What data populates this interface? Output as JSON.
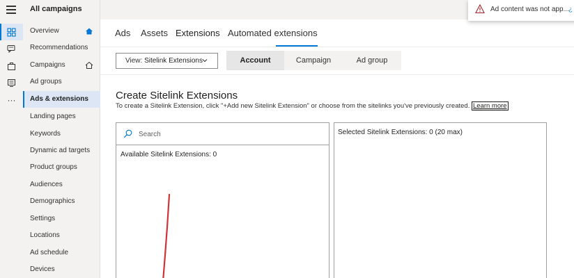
{
  "app": {
    "title": "All campaigns"
  },
  "toast": {
    "message": "Ad content was not app...",
    "trailing": "¿"
  },
  "nav": {
    "items": [
      {
        "label": "Overview",
        "icon": "home-icon"
      },
      {
        "label": "Recommendations"
      },
      {
        "label": "Campaigns",
        "icon": "home-outline-icon"
      },
      {
        "label": "Ad groups"
      },
      {
        "label": "Ads & extensions",
        "selected": true
      },
      {
        "label": "Landing pages"
      },
      {
        "label": "Keywords"
      },
      {
        "label": "Dynamic ad targets"
      },
      {
        "label": "Product groups"
      },
      {
        "label": "Audiences"
      },
      {
        "label": "Demographics"
      },
      {
        "label": "Settings"
      },
      {
        "label": "Locations"
      },
      {
        "label": "Ad schedule"
      },
      {
        "label": "Devices"
      }
    ]
  },
  "rail": {
    "more": "···"
  },
  "tabs": [
    {
      "label": "Ads"
    },
    {
      "label": "Assets"
    },
    {
      "label": "Extensions",
      "selected": true
    },
    {
      "label": "Automated extensions"
    }
  ],
  "view": {
    "prefix": "View:",
    "value": "Sitelink Extensions"
  },
  "scope": [
    {
      "label": "Account",
      "selected": true
    },
    {
      "label": "Campaign"
    },
    {
      "label": "Ad group"
    }
  ],
  "content": {
    "heading": "Create Sitelink Extensions",
    "description": "To create a Sitelink Extension, click \"+Add new Sitelink Extension\" or choose from the sitelinks you've previously created.",
    "learn_more": "Learn more",
    "search_placeholder": "Search",
    "available_label": "Available Sitelink Extensions:  0",
    "selected_label": "Selected Sitelink Extensions:  0 (20 max)"
  },
  "colors": {
    "accent": "#0078d4",
    "annotation": "#d13438",
    "warning": "#a4262c"
  }
}
